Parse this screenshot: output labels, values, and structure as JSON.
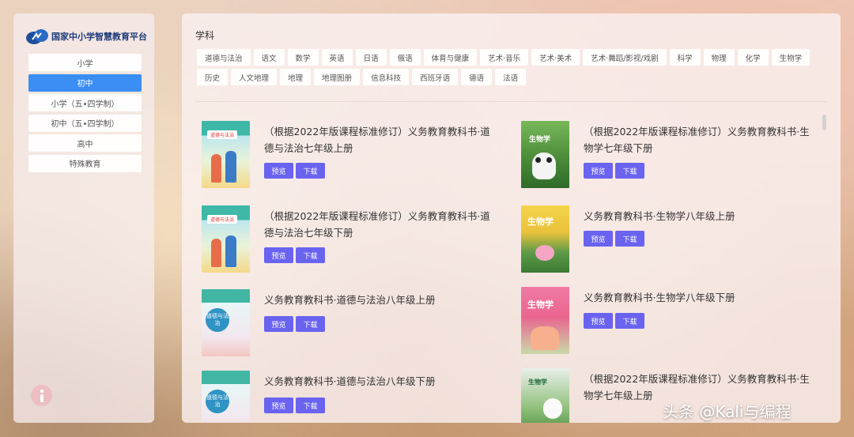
{
  "sidebar": {
    "logo_text": "国家中小学智慧教育平台",
    "levels": [
      "小学",
      "初中",
      "小学（五•四学制）",
      "初中（五•四学制）",
      "高中",
      "特殊教育"
    ],
    "active_level": "初中"
  },
  "main": {
    "subject_heading": "学科",
    "subjects": [
      "道德与法治",
      "语文",
      "数学",
      "英语",
      "日语",
      "俄语",
      "体育与健康",
      "艺术·音乐",
      "艺术·美术",
      "艺术·舞蹈/影视/戏剧",
      "科学",
      "物理",
      "化学",
      "生物学",
      "历史",
      "人文地理",
      "地理",
      "地理图册",
      "信息科技",
      "西班牙语",
      "德语",
      "法语"
    ],
    "books": [
      {
        "title": "（根据2022年版课程标准修订）义务教育教科书·道德与法治七年级上册",
        "cover_label": "道德与法治"
      },
      {
        "title": "（根据2022年版课程标准修订）义务教育教科书·生物学七年级下册",
        "cover_label": "生物学"
      },
      {
        "title": "（根据2022年版课程标准修订）义务教育教科书·道德与法治七年级下册",
        "cover_label": "道德与法治"
      },
      {
        "title": "义务教育教科书·生物学八年级上册",
        "cover_label": "生物学"
      },
      {
        "title": "义务教育教科书·道德与法治八年级上册",
        "cover_label": "道德与法治"
      },
      {
        "title": "义务教育教科书·生物学八年级下册",
        "cover_label": "生物学"
      },
      {
        "title": "义务教育教科书·道德与法治八年级下册",
        "cover_label": "道德与法治"
      },
      {
        "title": "（根据2022年版课程标准修订）义务教育教科书·生物学七年级上册",
        "cover_label": "生物学"
      }
    ],
    "preview_label": "预览",
    "download_label": "下载"
  },
  "watermark": "头条 @Kali与编程",
  "colors": {
    "active_blue": "#3a8ef4",
    "button_purple": "#6a63f0"
  },
  "icons": {
    "info": "info-icon",
    "logo": "cloud-book-logo-icon"
  }
}
